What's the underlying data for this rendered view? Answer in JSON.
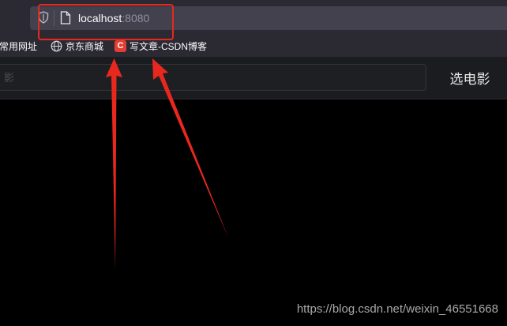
{
  "browser": {
    "url_host": "localhost",
    "url_port": ":8080",
    "bookmarks": [
      {
        "label": "常用网址",
        "icon": "folder-icon"
      },
      {
        "label": "京东商城",
        "icon": "globe-icon"
      },
      {
        "label": "写文章-CSDN博客",
        "icon": "csdn-icon",
        "icon_text": "C"
      }
    ]
  },
  "header": {
    "search_placeholder": "影",
    "select_movie_label": "选电影"
  },
  "watermark": "https://blog.csdn.net/weixin_46551668",
  "colors": {
    "annotation": "#e8281e",
    "toolbar": "#2b2a33",
    "url_bar": "#42414d",
    "header": "#1b1c1f",
    "content": "#000000"
  }
}
